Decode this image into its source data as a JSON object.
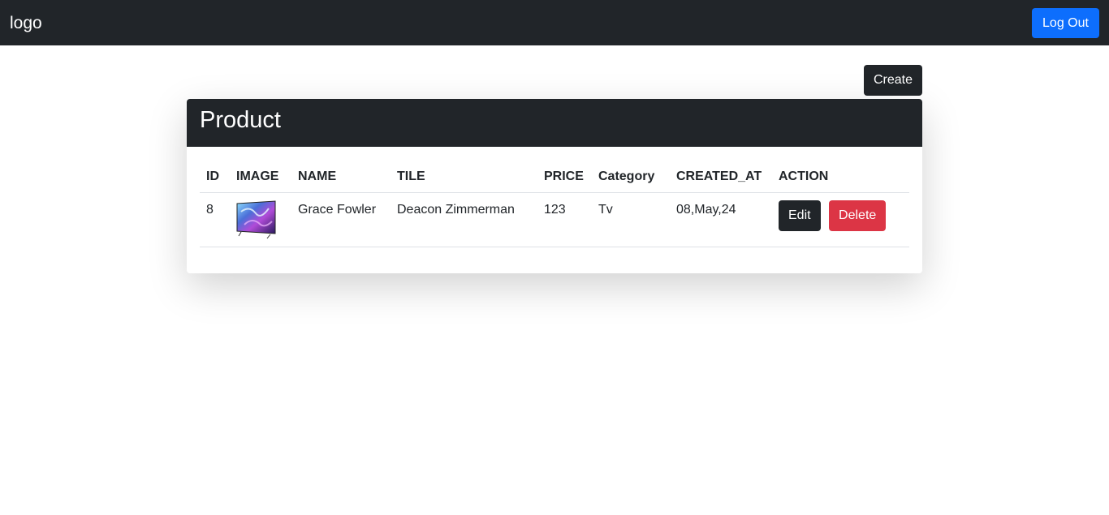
{
  "navbar": {
    "logo": "logo",
    "logout_label": "Log Out"
  },
  "toolbar": {
    "create_label": "Create"
  },
  "card": {
    "title": "Product"
  },
  "table": {
    "headers": [
      "ID",
      "IMAGE",
      "NAME",
      "TILE",
      "PRICE",
      "Category",
      "CREATED_AT",
      "ACTION"
    ],
    "rows": [
      {
        "id": "8",
        "image_icon": "tv-product-thumbnail",
        "name": "Grace Fowler",
        "tile": "Deacon Zimmerman",
        "price": "123",
        "category": "Tv",
        "created_at": "08,May,24",
        "edit_label": "Edit",
        "delete_label": "Delete"
      }
    ]
  },
  "colors": {
    "navbar_bg": "#212529",
    "primary": "#0d6efd",
    "danger": "#dc3545",
    "dark": "#212529"
  }
}
